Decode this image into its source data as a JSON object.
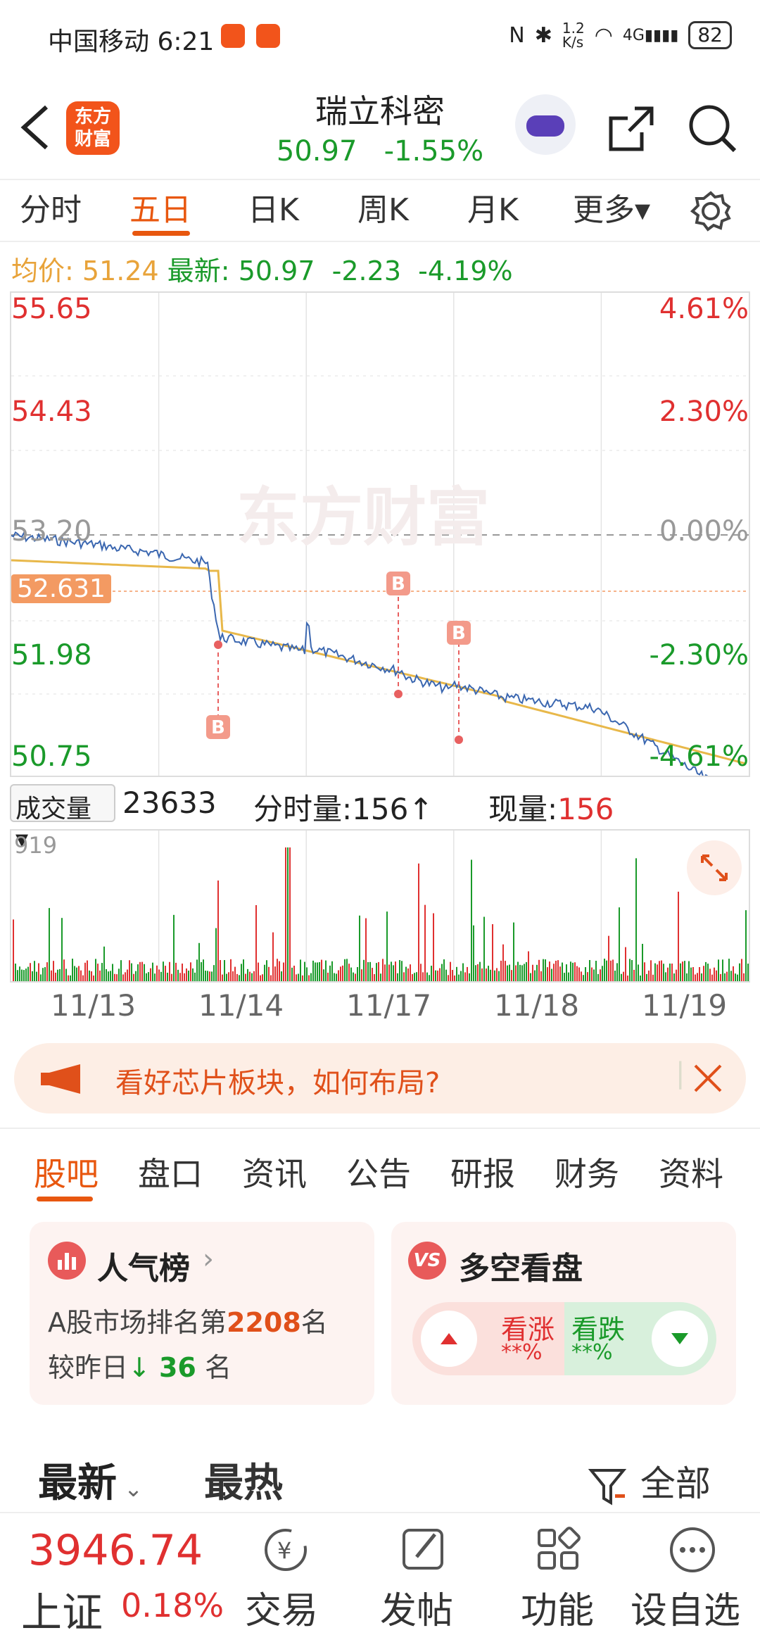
{
  "status_bar": {
    "carrier": "中国移动",
    "time": "6:21",
    "net_speed": "1.2\nK/s",
    "battery": "82",
    "network": "4G"
  },
  "header": {
    "stock_name": "瑞立科密",
    "price": "50.97",
    "change_pct": "-1.55%",
    "logo_text_1": "东方",
    "logo_text_2": "财富"
  },
  "tabs": [
    "分时",
    "五日",
    "日K",
    "周K",
    "月K",
    "更多▾"
  ],
  "summary": {
    "avg_label": "均价:",
    "avg_value": "51.24",
    "latest_label": "最新:",
    "latest_value": "50.97",
    "change": "-2.23",
    "change_pct": "-4.19%"
  },
  "chart": {
    "y_left": [
      "55.65",
      "54.43",
      "53.20",
      "51.98",
      "50.75"
    ],
    "y_right": [
      "4.61%",
      "2.30%",
      "0.00%",
      "-2.30%",
      "-4.61%"
    ],
    "current_marker": "52.631",
    "watermark": "东方财富",
    "markers": [
      "B",
      "B",
      "B"
    ],
    "colors": {
      "up": "#e03030",
      "down": "#1a9a2a",
      "price_line": "#3b67b0",
      "avg_line": "#e8b84a"
    }
  },
  "volume": {
    "selector": "成交量",
    "total": "23633",
    "minute_label": "分时量:",
    "minute_value": "156↑",
    "now_label": "现量:",
    "now_value": "156",
    "max_tick": "919"
  },
  "dates": [
    "11/13",
    "11/14",
    "11/17",
    "11/18",
    "11/19"
  ],
  "banner": {
    "text": "看好芯片板块，如何布局?"
  },
  "subtabs": [
    "股吧",
    "盘口",
    "资讯",
    "公告",
    "研报",
    "财务",
    "资料"
  ],
  "popularity": {
    "title": "人气榜",
    "line1_prefix": "A股市场排名第",
    "rank": "2208",
    "line1_suffix": "名",
    "line2_prefix": "较昨日",
    "change": "36",
    "line2_suffix": "名"
  },
  "bullbear": {
    "title": "多空看盘",
    "bull_label": "看涨",
    "bear_label": "看跌",
    "bull_pct": "**%",
    "bear_pct": "**%"
  },
  "feed": {
    "latest": "最新",
    "hot": "最热",
    "filter": "全部"
  },
  "bottom": {
    "index_value": "3946.74",
    "index_name": "上证",
    "index_change": "0.18%",
    "nav": [
      "交易",
      "发帖",
      "功能",
      "设自选"
    ]
  }
}
